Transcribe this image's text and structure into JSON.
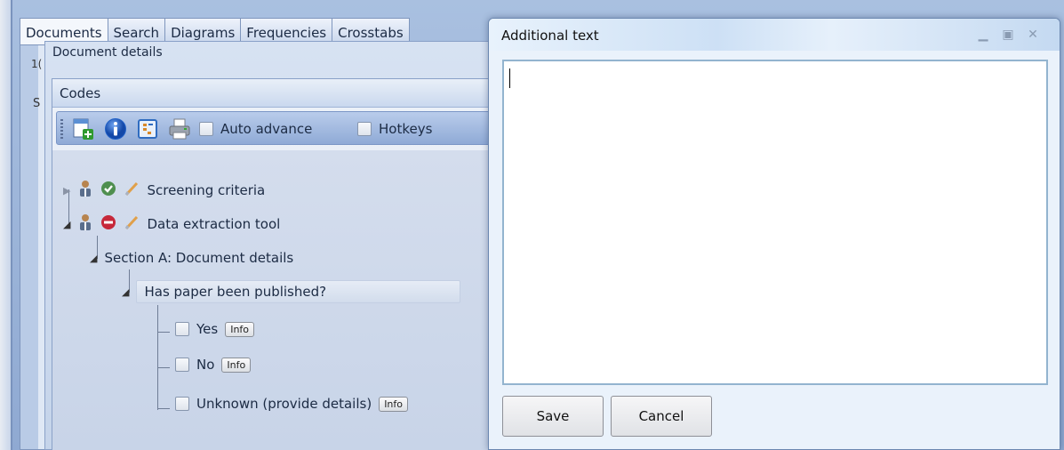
{
  "tabs": [
    "Documents",
    "Search",
    "Diagrams",
    "Frequencies",
    "Crosstabs"
  ],
  "grid": {
    "row_number_fragment": "1(",
    "row_s_fragment": "S"
  },
  "document_panel": {
    "title": "Document details"
  },
  "codes_panel": {
    "title": "Codes",
    "toolbar": {
      "auto_advance_label": "Auto advance",
      "hotkeys_label": "Hotkeys"
    },
    "tree": {
      "screening": "Screening criteria",
      "data_extraction": "Data extraction tool",
      "section_a": "Section A: Document details",
      "question": "Has paper been published?",
      "options": [
        {
          "label": "Yes",
          "info": "Info"
        },
        {
          "label": "No",
          "info": "Info"
        },
        {
          "label": "Unknown (provide details)",
          "info": "Info"
        }
      ]
    }
  },
  "dialog": {
    "title": "Additional text",
    "text_value": "",
    "save_label": "Save",
    "cancel_label": "Cancel"
  }
}
